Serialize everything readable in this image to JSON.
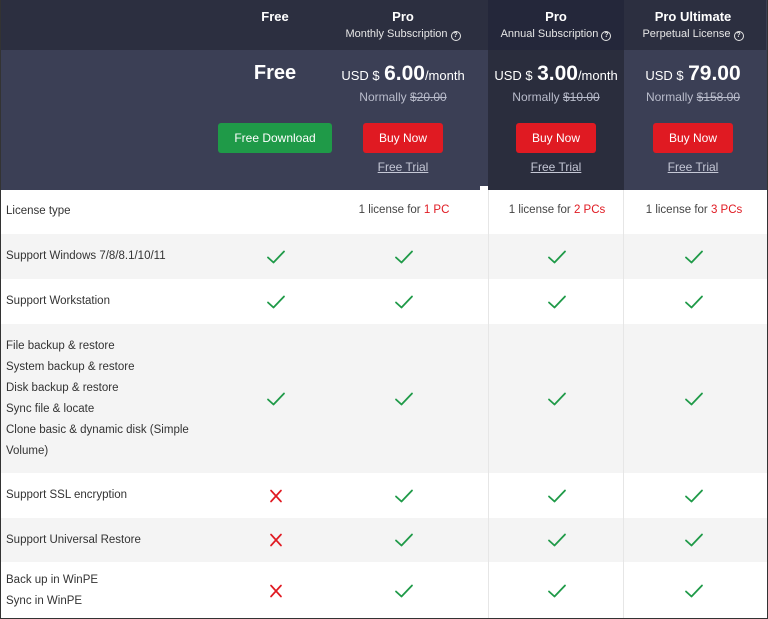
{
  "plans": {
    "free": {
      "name": "Free",
      "subtitle": "",
      "price_label": "Free",
      "button": "Free Download"
    },
    "monthly": {
      "name": "Pro",
      "subtitle": "Monthly Subscription",
      "currency": "USD $",
      "amount": "6.00",
      "period": "/month",
      "normally_label": "Normally",
      "old_price": "$20.00",
      "button": "Buy Now",
      "trial": "Free Trial"
    },
    "annual": {
      "name": "Pro",
      "subtitle": "Annual Subscription",
      "currency": "USD $",
      "amount": "3.00",
      "period": "/month",
      "normally_label": "Normally",
      "old_price": "$10.00",
      "button": "Buy Now",
      "trial": "Free Trial"
    },
    "perpetual": {
      "name": "Pro Ultimate",
      "subtitle": "Perpetual License",
      "currency": "USD $",
      "amount": "79.00",
      "period": "",
      "normally_label": "Normally",
      "old_price": "$158.00",
      "button": "Buy Now",
      "trial": "Free Trial"
    }
  },
  "help_icon": "question-circle-icon",
  "colors": {
    "header": "#3b3f55",
    "header_top": "#2c2f40",
    "green_button": "#1f9a48",
    "red_button": "#e01a22",
    "check": "#1f9a48",
    "cross": "#e01a22"
  },
  "license": {
    "feature": "License type",
    "monthly": {
      "prefix": "1 license for ",
      "count": "1 PC"
    },
    "annual": {
      "prefix": "1 license for ",
      "count": "2 PCs"
    },
    "perpetual": {
      "prefix": "1 license for ",
      "count": "3 PCs"
    }
  },
  "features": [
    {
      "lines": [
        "Support Windows 7/8/8.1/10/11"
      ],
      "free": "check",
      "monthly": "check",
      "annual": "check",
      "perpetual": "check"
    },
    {
      "lines": [
        "Support Workstation"
      ],
      "free": "check",
      "monthly": "check",
      "annual": "check",
      "perpetual": "check"
    },
    {
      "lines": [
        "File backup & restore",
        "System backup & restore",
        "Disk backup & restore",
        "Sync file & locate",
        "Clone basic & dynamic disk (Simple",
        "Volume)"
      ],
      "free": "check",
      "monthly": "check",
      "annual": "check",
      "perpetual": "check"
    },
    {
      "lines": [
        "Support SSL encryption"
      ],
      "free": "cross",
      "monthly": "check",
      "annual": "check",
      "perpetual": "check"
    },
    {
      "lines": [
        "Support Universal Restore"
      ],
      "free": "cross",
      "monthly": "check",
      "annual": "check",
      "perpetual": "check"
    },
    {
      "lines": [
        "Back up in WinPE",
        "Sync in WinPE"
      ],
      "free": "cross",
      "monthly": "check",
      "annual": "check",
      "perpetual": "check"
    }
  ]
}
